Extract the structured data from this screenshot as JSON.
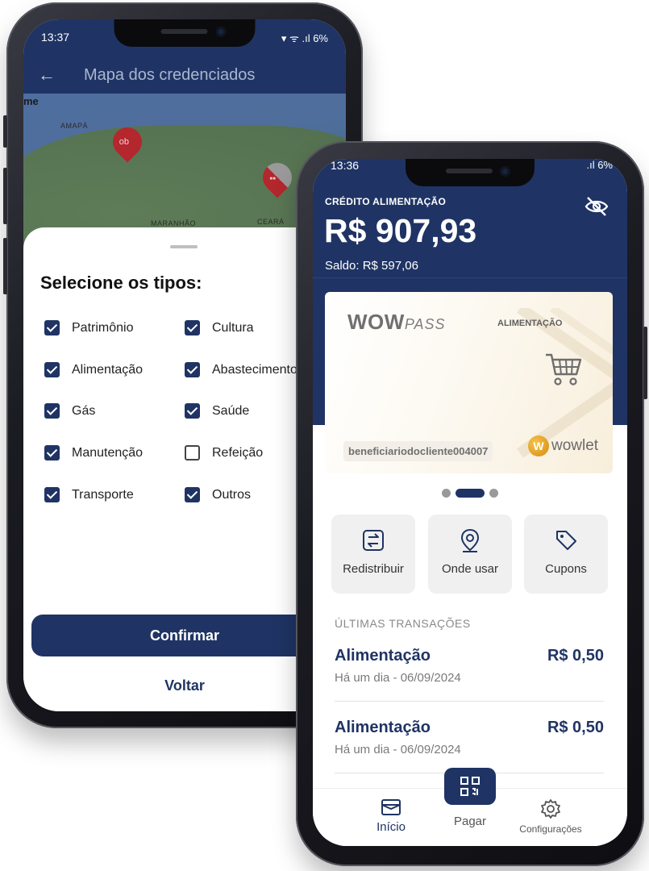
{
  "left_screen": {
    "status_time": "13:37",
    "status_battery": "6%",
    "title": "Mapa dos credenciados",
    "map_labels": [
      "me",
      "AMAPÁ",
      "MARANHÃO",
      "CEARÁ"
    ],
    "sheet_title": "Selecione os tipos:",
    "types": [
      {
        "label": "Patrimônio",
        "checked": true
      },
      {
        "label": "Cultura",
        "checked": true
      },
      {
        "label": "Alimentação",
        "checked": true
      },
      {
        "label": "Abastecimento",
        "checked": true
      },
      {
        "label": "Gás",
        "checked": true
      },
      {
        "label": "Saúde",
        "checked": true
      },
      {
        "label": "Manutenção",
        "checked": true
      },
      {
        "label": "Refeição",
        "checked": false
      },
      {
        "label": "Transporte",
        "checked": true
      },
      {
        "label": "Outros",
        "checked": true
      }
    ],
    "confirm_label": "Confirmar",
    "back_label": "Voltar"
  },
  "right_screen": {
    "status_time": "13:36",
    "status_battery": "6%",
    "balance_label": "CRÉDITO ALIMENTAÇÃO",
    "balance_amount": "R$ 907,93",
    "saldo": "Saldo: R$ 597,06",
    "card": {
      "brand_bold": "WOW",
      "brand_light": "PASS",
      "type": "ALIMENTAÇÃO",
      "holder": "beneficiariodocliente004007",
      "issuer": "wowlet"
    },
    "actions": [
      {
        "label": "Redistribuir",
        "icon": "transfer-icon"
      },
      {
        "label": "Onde usar",
        "icon": "location-pin-icon"
      },
      {
        "label": "Cupons",
        "icon": "tag-icon"
      }
    ],
    "transactions_title": "ÚLTIMAS TRANSAÇÕES",
    "transactions": [
      {
        "name": "Alimentação",
        "date": "Há um dia - 06/09/2024",
        "amount": "R$ 0,50"
      },
      {
        "name": "Alimentação",
        "date": "Há um dia - 06/09/2024",
        "amount": "R$ 0,50"
      }
    ],
    "nav": {
      "home": "Início",
      "pay": "Pagar",
      "settings": "Configurações"
    }
  },
  "colors": {
    "primary": "#1f3464",
    "pin": "#b3272d"
  }
}
